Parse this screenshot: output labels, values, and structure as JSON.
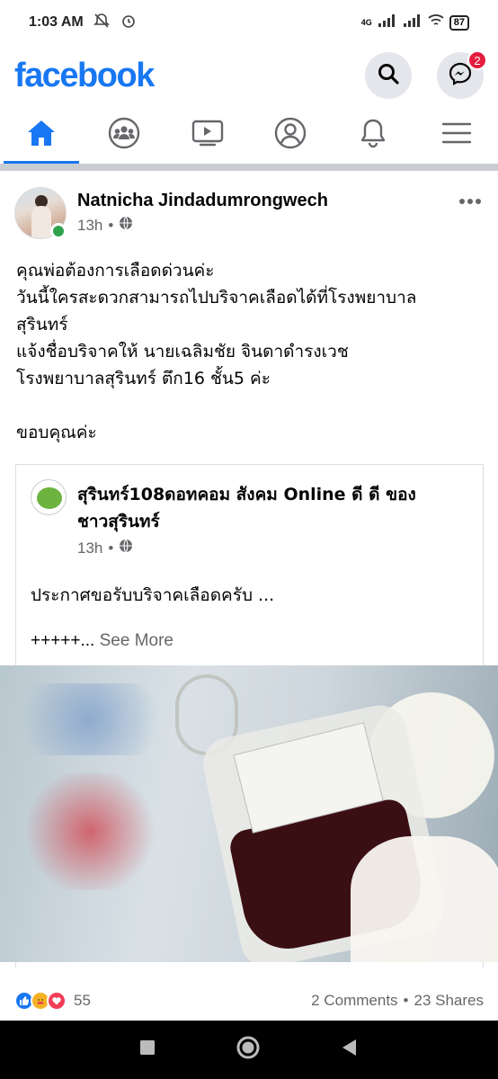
{
  "status_bar": {
    "time": "1:03 AM",
    "network": "4G",
    "battery": "87"
  },
  "header": {
    "logo": "facebook",
    "messenger_badge": "2"
  },
  "nav_tabs": [
    {
      "name": "home",
      "active": true
    },
    {
      "name": "groups",
      "active": false
    },
    {
      "name": "watch",
      "active": false
    },
    {
      "name": "profile",
      "active": false
    },
    {
      "name": "notifications",
      "active": false
    },
    {
      "name": "menu",
      "active": false
    }
  ],
  "post": {
    "author": "Natnicha Jindadumrongwech",
    "time": "13h",
    "privacy_icon": "globe-icon",
    "text_lines": [
      "คุณพ่อต้องการเลือดด่วนค่ะ",
      "วันนี้ใครสะดวกสามารถไปบริจาคเลือดได้ที่โรงพยาบาล",
      "สุรินทร์",
      "แจ้งชื่อบริจาคให้ นายเฉลิมชัย จินดาดำรงเวช",
      "โรงพยาบาลสุรินทร์ ตึก16 ชั้น5 ค่ะ",
      "",
      "ขอบคุณค่ะ"
    ],
    "shared": {
      "author_line1": "สุรินทร์108ดอทคอม สังคม Online ดี ดี ของ",
      "author_line2": "ชาวสุรินทร์",
      "time": "13h",
      "text": "ประกาศขอรับบริจาคเลือดครับ ...",
      "text2": "+++++...",
      "see_more": "See More"
    },
    "reaction_count": "55",
    "comments": "2 Comments",
    "shares": "23 Shares",
    "separator_dot": "•"
  },
  "colors": {
    "brand": "#1877f2",
    "secondary_text": "#65676b",
    "online": "#31a24c",
    "badge": "#e41e3f"
  }
}
